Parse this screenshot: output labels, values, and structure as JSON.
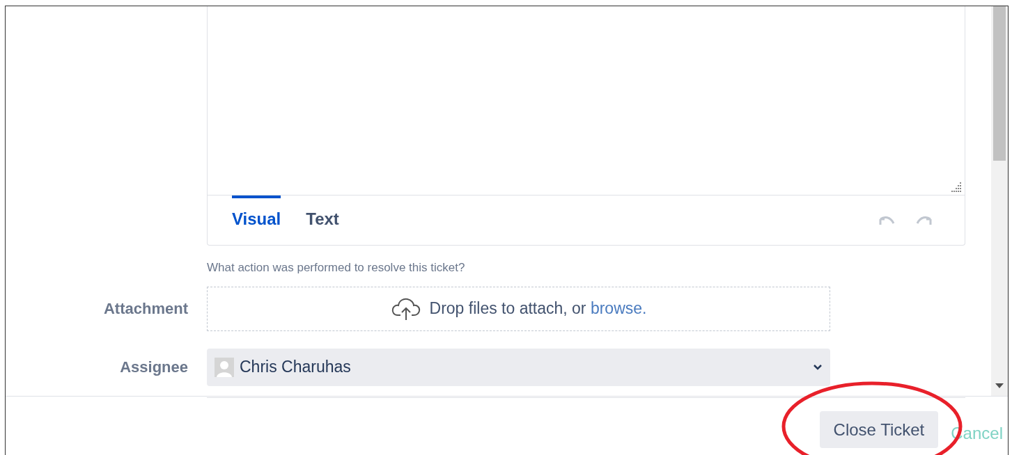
{
  "editor": {
    "tabs": [
      {
        "label": "Visual",
        "selected": true
      },
      {
        "label": "Text",
        "selected": false
      }
    ],
    "hint": "What action was performed to resolve this ticket?"
  },
  "attachment": {
    "label": "Attachment",
    "text": "Drop files to attach, or",
    "link": "browse."
  },
  "assignee": {
    "label": "Assignee",
    "value": "Chris Charuhas"
  },
  "footer": {
    "primary": "Close Ticket",
    "cancel": "Cancel"
  }
}
